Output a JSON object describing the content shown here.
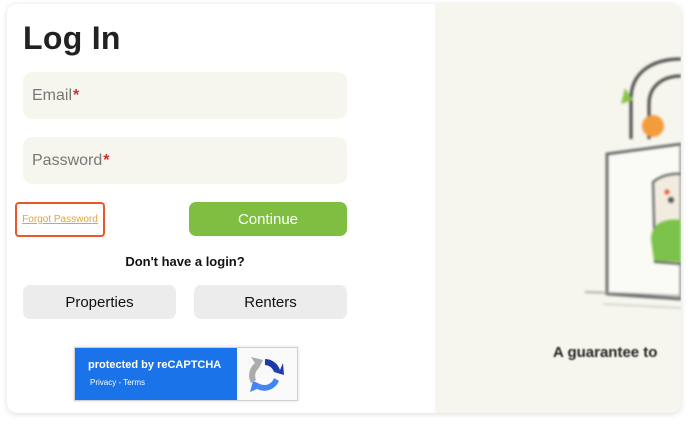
{
  "login": {
    "title": "Log In",
    "email_label": "Email",
    "password_label": "Password",
    "required_mark": "*",
    "forgot_password": "Forgot Password",
    "continue_label": "Continue",
    "no_login_text": "Don't have a login?",
    "properties_label": "Properties",
    "renters_label": "Renters"
  },
  "recaptcha": {
    "protected_text": "protected by reCAPTCHA",
    "privacy": "Privacy",
    "separator": " - ",
    "terms": "Terms"
  },
  "promo": {
    "headline": "A guarantee to"
  },
  "colors": {
    "accent_green": "#80be41",
    "highlight_orange": "#e8562a",
    "link_orange": "#e6a23c",
    "required_red": "#d32f2f",
    "recaptcha_blue": "#1a73e8"
  },
  "icons": {
    "recaptcha": "recaptcha-logo-icon",
    "illustration": "padlock-illustration"
  }
}
